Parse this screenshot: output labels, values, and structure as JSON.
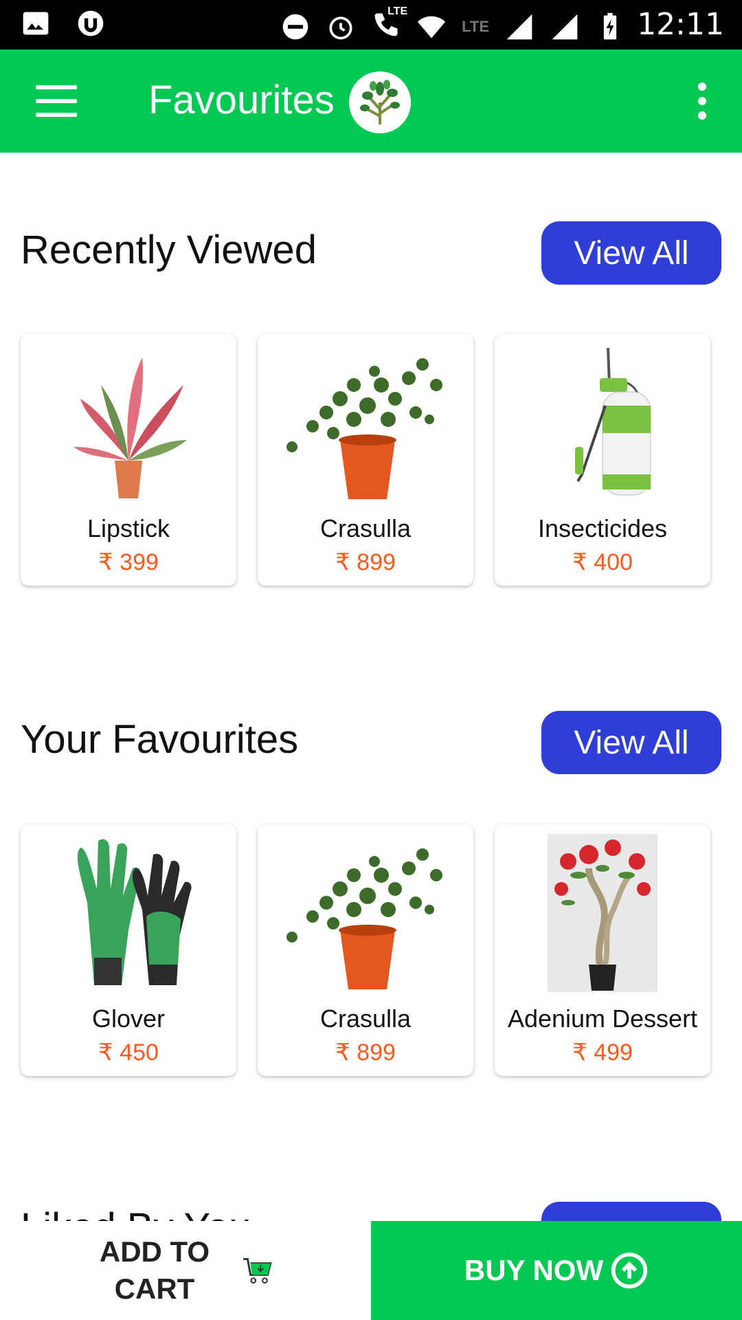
{
  "status_bar": {
    "time": "12:11",
    "lte_small": "LTE",
    "lte_call": "LTE"
  },
  "app_bar": {
    "title": "Favourites"
  },
  "colors": {
    "primary_green": "#00c853",
    "button_blue": "#2f3ed6",
    "price_orange": "#ff5a1f"
  },
  "sections": [
    {
      "title": "Recently Viewed",
      "view_all_label": "View All",
      "items": [
        {
          "name": "Lipstick",
          "price": "₹ 399",
          "image": "red-leaf-plant"
        },
        {
          "name": "Crasulla",
          "price": "₹ 899",
          "image": "jade-plant-orange-pot"
        },
        {
          "name": "Insecticides",
          "price": "₹ 400",
          "image": "pump-sprayer"
        }
      ]
    },
    {
      "title": "Your Favourites",
      "view_all_label": "View All",
      "items": [
        {
          "name": "Glover",
          "price": "₹ 450",
          "image": "garden-gloves"
        },
        {
          "name": "Crasulla",
          "price": "₹ 899",
          "image": "jade-plant-orange-pot"
        },
        {
          "name": "Adenium Dessert",
          "price": "₹ 499",
          "image": "adenium-flower-plant"
        }
      ]
    }
  ],
  "third_section_peek": {
    "title": "Liked By You"
  },
  "bottom_bar": {
    "add_to_cart_label": "ADD TO CART",
    "buy_now_label": "BUY NOW"
  }
}
